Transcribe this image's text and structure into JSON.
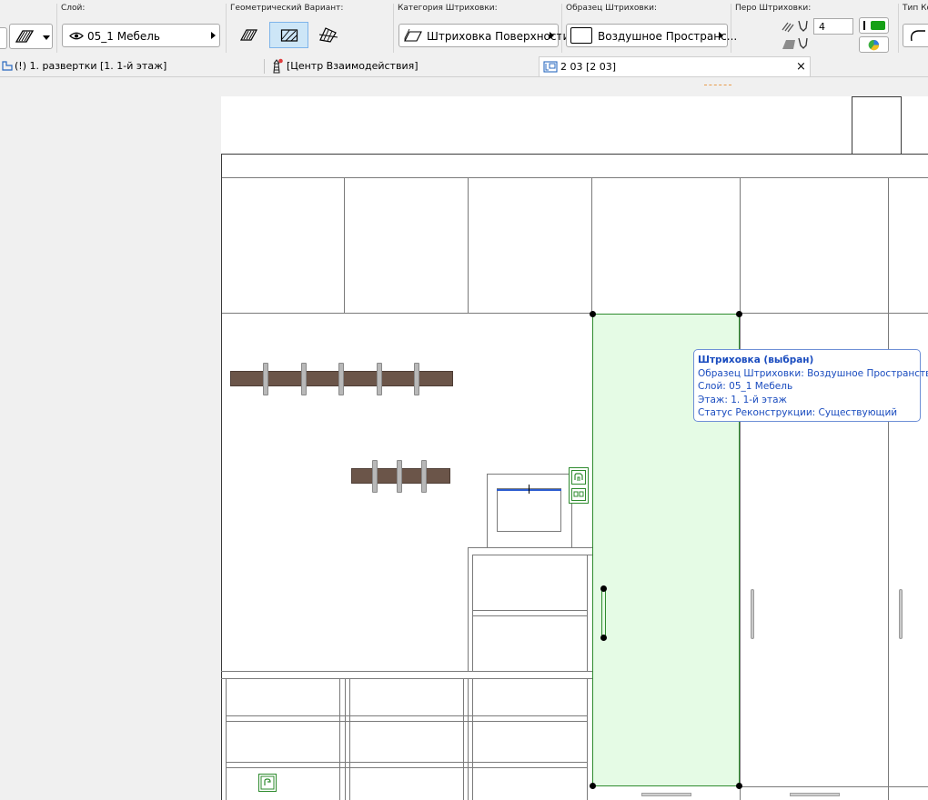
{
  "toolbar": {
    "layer_label": "Слой:",
    "layer_value": "05_1 Мебель",
    "geometry_label": "Геометрический Вариант:",
    "hatch_category_label": "Категория Штриховки:",
    "hatch_category_value": "Штриховка Поверхности",
    "hatch_pattern_label": "Образец Штриховки:",
    "hatch_pattern_value": "Воздушное Пространс...",
    "pen_label": "Перо Штриховки:",
    "pen_value": "4",
    "type_label": "Тип Ко"
  },
  "tabs": [
    {
      "label": "(!) 1. развертки [1. 1-й этаж]"
    },
    {
      "label": "[Центр Взаимодействия]"
    },
    {
      "label": "2 03 [2 03]",
      "close": "×"
    }
  ],
  "tooltip": {
    "title": "Штриховка (выбран)",
    "line1": "Образец Штриховки: Воздушное Пространство",
    "line2": "Слой: 05_1 Мебель",
    "line3": "Этаж: 1. 1-й этаж",
    "line4": "Статус Реконструкции: Существующий"
  },
  "colors": {
    "selection_fill": "#e5fbe5",
    "selection_stroke": "#2e8b2e",
    "tooltip_text": "#1a4cbf",
    "tooltip_border": "#6e8fd6",
    "shelf": "#6b5549",
    "pen_green": "#16a016"
  }
}
